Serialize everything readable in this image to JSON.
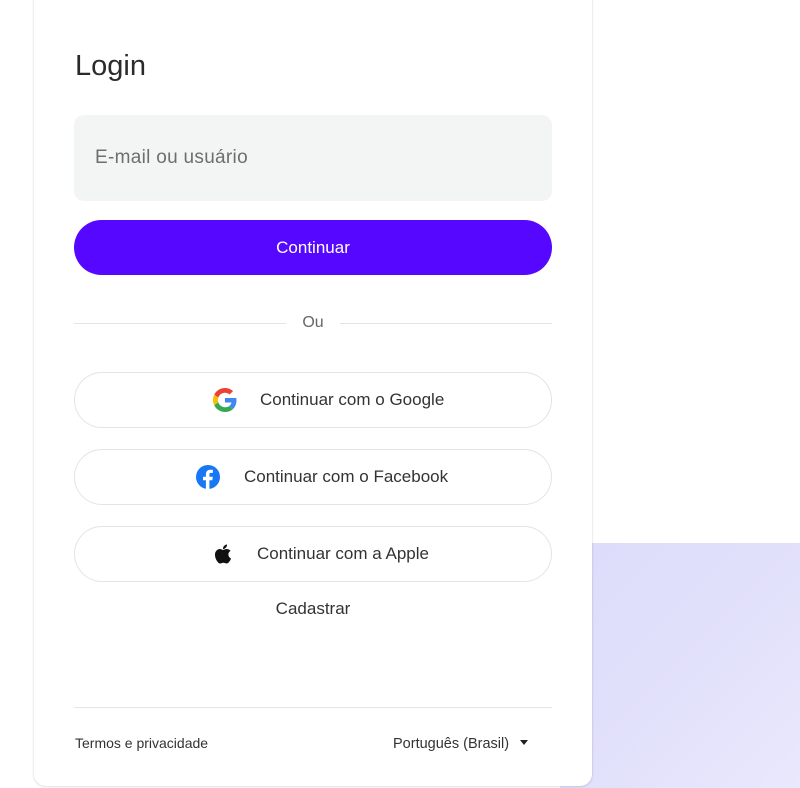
{
  "login": {
    "title": "Login",
    "email_placeholder": "E-mail ou usuário",
    "continue_label": "Continuar",
    "divider_text": "Ou",
    "social": {
      "google_label": "Continuar com o Google",
      "facebook_label": "Continuar com o Facebook",
      "apple_label": "Continuar com a Apple"
    },
    "signup_label": "Cadastrar"
  },
  "footer": {
    "terms_label": "Termos e privacidade",
    "language_label": "Português (Brasil)"
  },
  "icons": {
    "google": "google-icon",
    "facebook": "facebook-icon",
    "apple": "apple-icon",
    "language_caret": "caret-down-icon"
  },
  "colors": {
    "primary": "#5607ff",
    "input_bg": "#f3f4f4",
    "facebook": "#1877f2",
    "background_panel": "#e0dffb"
  }
}
